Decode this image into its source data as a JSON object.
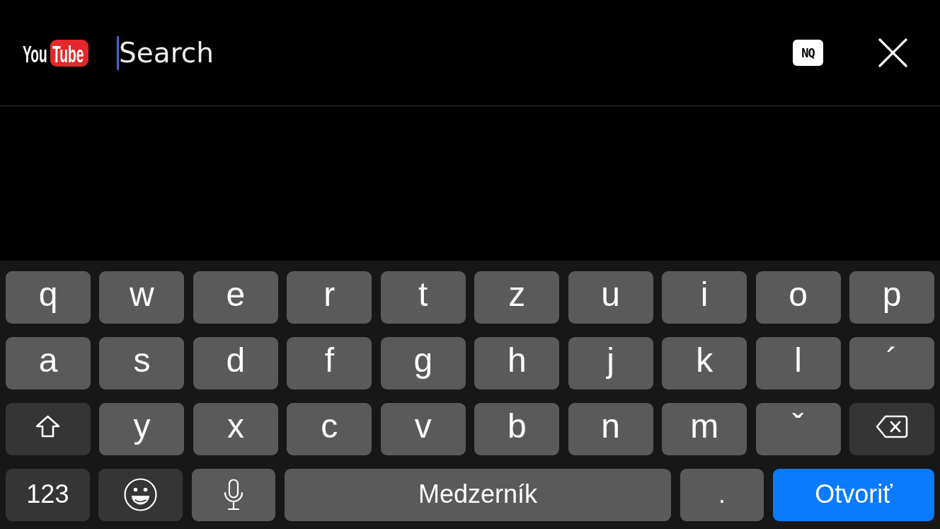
{
  "header": {
    "logo": {
      "text": "You",
      "badge_text": "Tube"
    },
    "search": {
      "placeholder": "Search",
      "focused": true
    },
    "badge": "NQ"
  },
  "keyboard": {
    "rows": [
      {
        "keys": [
          {
            "kind": "letter",
            "label": "q"
          },
          {
            "kind": "letter",
            "label": "w"
          },
          {
            "kind": "letter",
            "label": "e"
          },
          {
            "kind": "letter",
            "label": "r"
          },
          {
            "kind": "letter",
            "label": "t"
          },
          {
            "kind": "letter",
            "label": "z"
          },
          {
            "kind": "letter",
            "label": "u"
          },
          {
            "kind": "letter",
            "label": "i"
          },
          {
            "kind": "letter",
            "label": "o"
          },
          {
            "kind": "letter",
            "label": "p"
          }
        ]
      },
      {
        "keys": [
          {
            "kind": "letter",
            "label": "a"
          },
          {
            "kind": "letter",
            "label": "s"
          },
          {
            "kind": "letter",
            "label": "d"
          },
          {
            "kind": "letter",
            "label": "f"
          },
          {
            "kind": "letter",
            "label": "g"
          },
          {
            "kind": "letter",
            "label": "h"
          },
          {
            "kind": "letter",
            "label": "j"
          },
          {
            "kind": "letter",
            "label": "k"
          },
          {
            "kind": "letter",
            "label": "l"
          },
          {
            "kind": "letter",
            "label": "´"
          }
        ]
      },
      {
        "keys": [
          {
            "kind": "shift"
          },
          {
            "kind": "letter",
            "label": "y"
          },
          {
            "kind": "letter",
            "label": "x"
          },
          {
            "kind": "letter",
            "label": "c"
          },
          {
            "kind": "letter",
            "label": "v"
          },
          {
            "kind": "letter",
            "label": "b"
          },
          {
            "kind": "letter",
            "label": "n"
          },
          {
            "kind": "letter",
            "label": "m"
          },
          {
            "kind": "letter",
            "label": "ˇ"
          },
          {
            "kind": "delete"
          }
        ]
      },
      {
        "keys": [
          {
            "kind": "numbers",
            "label": "123"
          },
          {
            "kind": "emoji"
          },
          {
            "kind": "dictation"
          },
          {
            "kind": "space",
            "label": "Medzerník"
          },
          {
            "kind": "period",
            "label": "."
          },
          {
            "kind": "return",
            "label": "Otvoriť"
          }
        ]
      }
    ]
  }
}
